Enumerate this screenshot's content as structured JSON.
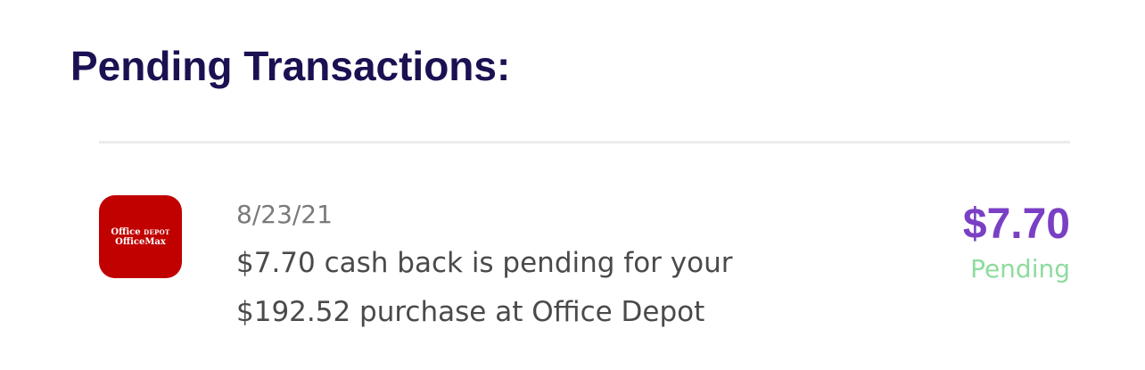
{
  "section": {
    "title": "Pending Transactions:"
  },
  "colors": {
    "title": "#1b1152",
    "amount": "#7a3fc4",
    "status": "#8edc9e",
    "logo_bg": "#c10000",
    "divider": "#ececec"
  },
  "transactions": [
    {
      "merchant_logo": {
        "line1_main": "Office",
        "line1_small": "DEPOT",
        "line2": "OfficeMax"
      },
      "date": "8/23/21",
      "description_line1": "$7.70 cash back is pending for your",
      "description_line2": "$192.52 purchase at Office Depot",
      "amount": "$7.70",
      "status": "Pending"
    }
  ]
}
